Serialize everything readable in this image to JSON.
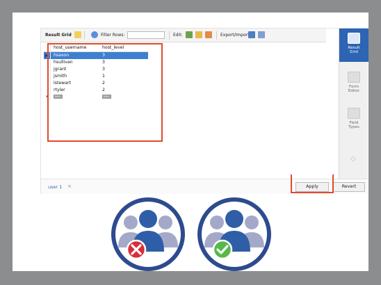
{
  "toolbar": {
    "result_grid_label": "Result Grid",
    "filter_label": "Filter Rows:",
    "edit_label": "Edit:",
    "export_label": "Export/Import:"
  },
  "grid": {
    "columns": [
      "host_username",
      "host_level"
    ],
    "rows": [
      {
        "username": "hsaxon",
        "level": "3"
      },
      {
        "username": "hsullivan",
        "level": "3"
      },
      {
        "username": "jgrant",
        "level": "3"
      },
      {
        "username": "jsmith",
        "level": "1"
      },
      {
        "username": "lstewart",
        "level": "2"
      },
      {
        "username": "rtyler",
        "level": "2"
      }
    ],
    "null_label": "NULL"
  },
  "sidebar": {
    "items": [
      {
        "label_line1": "Result",
        "label_line2": "Grid"
      },
      {
        "label_line1": "Form",
        "label_line2": "Editor"
      },
      {
        "label_line1": "Field",
        "label_line2": "Types"
      }
    ]
  },
  "bottom": {
    "tab_label": "user 1",
    "tab_close": "×",
    "apply_label": "Apply",
    "revert_label": "Revert"
  },
  "colors": {
    "badge_blue": "#2d4b8e",
    "user_main": "#2f5ea8",
    "user_side": "#a4a9c9",
    "error_red": "#d62f3b",
    "success_green": "#57b84a",
    "highlight": "#e04a2a"
  },
  "icons": {
    "left_badge": "users-denied-icon",
    "right_badge": "users-approved-icon"
  }
}
